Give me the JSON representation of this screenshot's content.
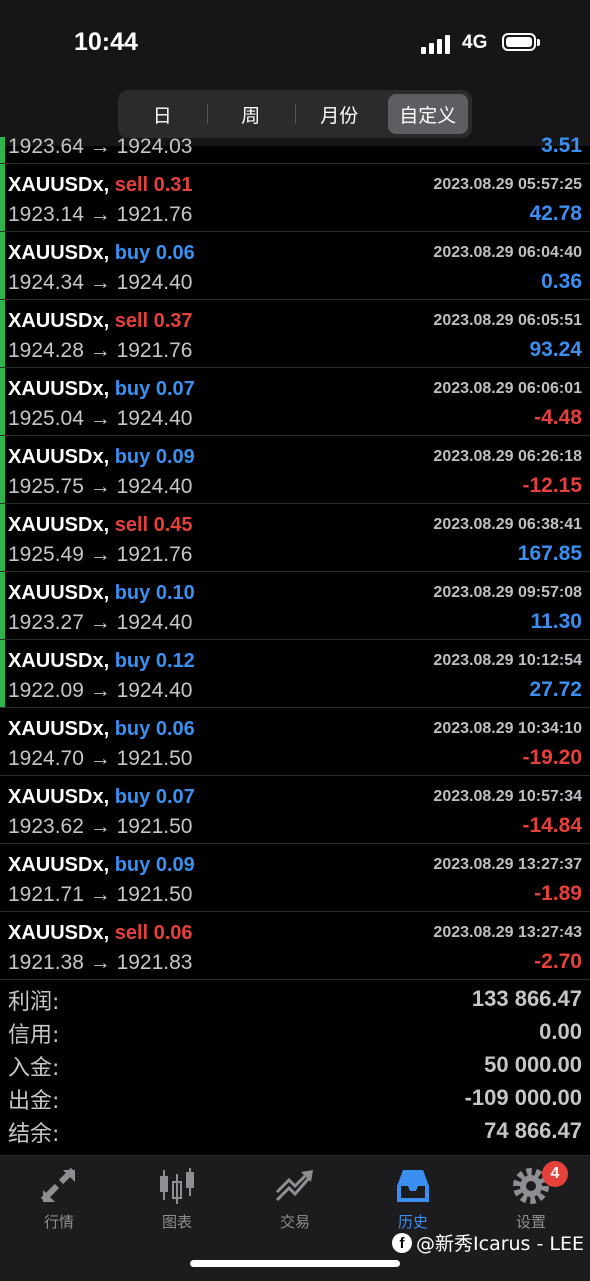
{
  "status_bar": {
    "time": "10:44",
    "network": "4G"
  },
  "period_tabs": [
    {
      "label": "日",
      "active": false
    },
    {
      "label": "周",
      "active": false
    },
    {
      "label": "月份",
      "active": false
    },
    {
      "label": "自定义",
      "active": true
    }
  ],
  "partial_row": {
    "prices": "1923.64 → 1924.03",
    "profit": "3.51"
  },
  "trades": [
    {
      "symbol": "XAUUSDx,",
      "side": "sell",
      "volume": "0.31",
      "time": "2023.08.29 05:57:25",
      "prices": "1923.14 → 1921.76",
      "profit": "42.78",
      "bar": true
    },
    {
      "symbol": "XAUUSDx,",
      "side": "buy",
      "volume": "0.06",
      "time": "2023.08.29 06:04:40",
      "prices": "1924.34 → 1924.40",
      "profit": "0.36",
      "bar": true
    },
    {
      "symbol": "XAUUSDx,",
      "side": "sell",
      "volume": "0.37",
      "time": "2023.08.29 06:05:51",
      "prices": "1924.28 → 1921.76",
      "profit": "93.24",
      "bar": true
    },
    {
      "symbol": "XAUUSDx,",
      "side": "buy",
      "volume": "0.07",
      "time": "2023.08.29 06:06:01",
      "prices": "1925.04 → 1924.40",
      "profit": "-4.48",
      "bar": true
    },
    {
      "symbol": "XAUUSDx,",
      "side": "buy",
      "volume": "0.09",
      "time": "2023.08.29 06:26:18",
      "prices": "1925.75 → 1924.40",
      "profit": "-12.15",
      "bar": true
    },
    {
      "symbol": "XAUUSDx,",
      "side": "sell",
      "volume": "0.45",
      "time": "2023.08.29 06:38:41",
      "prices": "1925.49 → 1921.76",
      "profit": "167.85",
      "bar": true
    },
    {
      "symbol": "XAUUSDx,",
      "side": "buy",
      "volume": "0.10",
      "time": "2023.08.29 09:57:08",
      "prices": "1923.27 → 1924.40",
      "profit": "11.30",
      "bar": true
    },
    {
      "symbol": "XAUUSDx,",
      "side": "buy",
      "volume": "0.12",
      "time": "2023.08.29 10:12:54",
      "prices": "1922.09 → 1924.40",
      "profit": "27.72",
      "bar": true
    },
    {
      "symbol": "XAUUSDx,",
      "side": "buy",
      "volume": "0.06",
      "time": "2023.08.29 10:34:10",
      "prices": "1924.70 → 1921.50",
      "profit": "-19.20",
      "bar": false
    },
    {
      "symbol": "XAUUSDx,",
      "side": "buy",
      "volume": "0.07",
      "time": "2023.08.29 10:57:34",
      "prices": "1923.62 → 1921.50",
      "profit": "-14.84",
      "bar": false
    },
    {
      "symbol": "XAUUSDx,",
      "side": "buy",
      "volume": "0.09",
      "time": "2023.08.29 13:27:37",
      "prices": "1921.71 → 1921.50",
      "profit": "-1.89",
      "bar": false
    },
    {
      "symbol": "XAUUSDx,",
      "side": "sell",
      "volume": "0.06",
      "time": "2023.08.29 13:27:43",
      "prices": "1921.38 → 1921.83",
      "profit": "-2.70",
      "bar": false
    }
  ],
  "summary": [
    {
      "label": "利润:",
      "value": "133 866.47"
    },
    {
      "label": "信用:",
      "value": "0.00"
    },
    {
      "label": "入金:",
      "value": "50 000.00"
    },
    {
      "label": "出金:",
      "value": "-109 000.00"
    },
    {
      "label": "结余:",
      "value": "74 866.47"
    }
  ],
  "tab_bar": [
    {
      "label": "行情",
      "icon": "quotes-icon"
    },
    {
      "label": "图表",
      "icon": "chart-icon"
    },
    {
      "label": "交易",
      "icon": "trade-icon"
    },
    {
      "label": "历史",
      "icon": "history-icon",
      "active": true
    },
    {
      "label": "设置",
      "icon": "settings-icon",
      "badge": "4"
    }
  ],
  "watermark": "@新秀Icarus - LEE",
  "colors": {
    "buy": "#3b8ff0",
    "sell": "#e5403a",
    "bar": "#2fb54a",
    "background": "#000000"
  }
}
